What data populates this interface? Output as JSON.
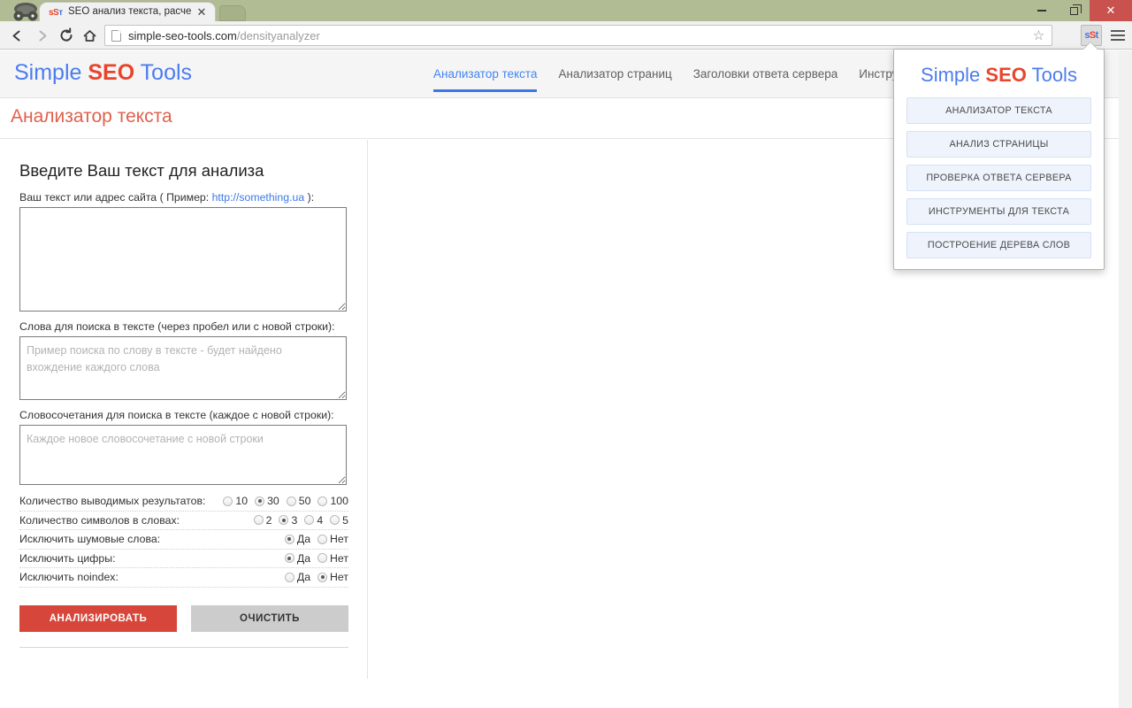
{
  "browser": {
    "tab": {
      "title": "SEO анализ текста, расче",
      "favicon_part1": "sS",
      "favicon_part2": "т",
      "close_label": "✕"
    },
    "new_tab_label": "",
    "toolbar": {
      "back_label": "←",
      "forward_label": "→",
      "reload_label": "⟳",
      "home_label": "⌂",
      "url_host": "simple-seo-tools.com",
      "url_path": "/densityanalyzer",
      "star_label": "☆",
      "extension_label_1": "s",
      "extension_label_2": "S",
      "extension_label_3": "t"
    },
    "window_controls": {
      "minimize": "",
      "maximize": "",
      "close": "✕"
    }
  },
  "site": {
    "logo": {
      "part1": "Simple ",
      "part2": "SEO",
      "part3": " Tools"
    },
    "nav": [
      {
        "label": "Анализатор текста",
        "active": true
      },
      {
        "label": "Анализатор страниц",
        "active": false
      },
      {
        "label": "Заголовки ответа сервера",
        "active": false
      },
      {
        "label": "Инструменты д",
        "active": false
      }
    ],
    "page_title": "Анализатор текста"
  },
  "form": {
    "heading": "Введите Ваш текст для анализа",
    "main_field": {
      "label_before": "Ваш текст или адрес сайта ( Пример: ",
      "label_url": "http://something.ua",
      "label_after": " ):",
      "value": "",
      "placeholder": ""
    },
    "words_field": {
      "label": "Слова для поиска в тексте (через пробел или с новой строки):",
      "value": "",
      "placeholder": "Пример поиска по слову в тексте - будет найдено вхождение каждого слова"
    },
    "phrases_field": {
      "label": "Словосочетания для поиска в тексте (каждое с новой строки):",
      "value": "",
      "placeholder": "Каждое новое словосочетание с новой строки"
    },
    "options": [
      {
        "label": "Количество выводимых результатов:",
        "choices": [
          {
            "text": "10",
            "selected": false
          },
          {
            "text": "30",
            "selected": true
          },
          {
            "text": "50",
            "selected": false
          },
          {
            "text": "100",
            "selected": false
          }
        ]
      },
      {
        "label": "Количество символов в словах:",
        "choices": [
          {
            "text": "2",
            "selected": false
          },
          {
            "text": "3",
            "selected": true
          },
          {
            "text": "4",
            "selected": false
          },
          {
            "text": "5",
            "selected": false
          }
        ]
      },
      {
        "label": "Исключить шумовые слова:",
        "choices": [
          {
            "text": "Да",
            "selected": true
          },
          {
            "text": "Нет",
            "selected": false
          }
        ]
      },
      {
        "label": "Исключить цифры:",
        "choices": [
          {
            "text": "Да",
            "selected": true
          },
          {
            "text": "Нет",
            "selected": false
          }
        ]
      },
      {
        "label": "Исключить noindex:",
        "choices": [
          {
            "text": "Да",
            "selected": false
          },
          {
            "text": "Нет",
            "selected": true
          }
        ]
      }
    ],
    "buttons": {
      "analyze": "АНАЛИЗИРОВАТЬ",
      "clear": "ОЧИСТИТЬ"
    }
  },
  "popup": {
    "logo": {
      "part1": "Simple ",
      "part2": "SEO",
      "part3": " Tools"
    },
    "buttons": [
      "АНАЛИЗАТОР ТЕКСТА",
      "АНАЛИЗ СТРАНИЦЫ",
      "ПРОВЕРКА ОТВЕТА СЕРВЕРА",
      "ИНСТРУМЕНТЫ ДЛЯ ТЕКСТА",
      "ПОСТРОЕНИЕ ДЕРЕВА СЛОВ"
    ]
  },
  "colors": {
    "accent_blue": "#3b78e7",
    "accent_red": "#e8452c",
    "button_red": "#d6463a",
    "title_red": "#e0614d",
    "chrome_green": "#b2bc94"
  }
}
